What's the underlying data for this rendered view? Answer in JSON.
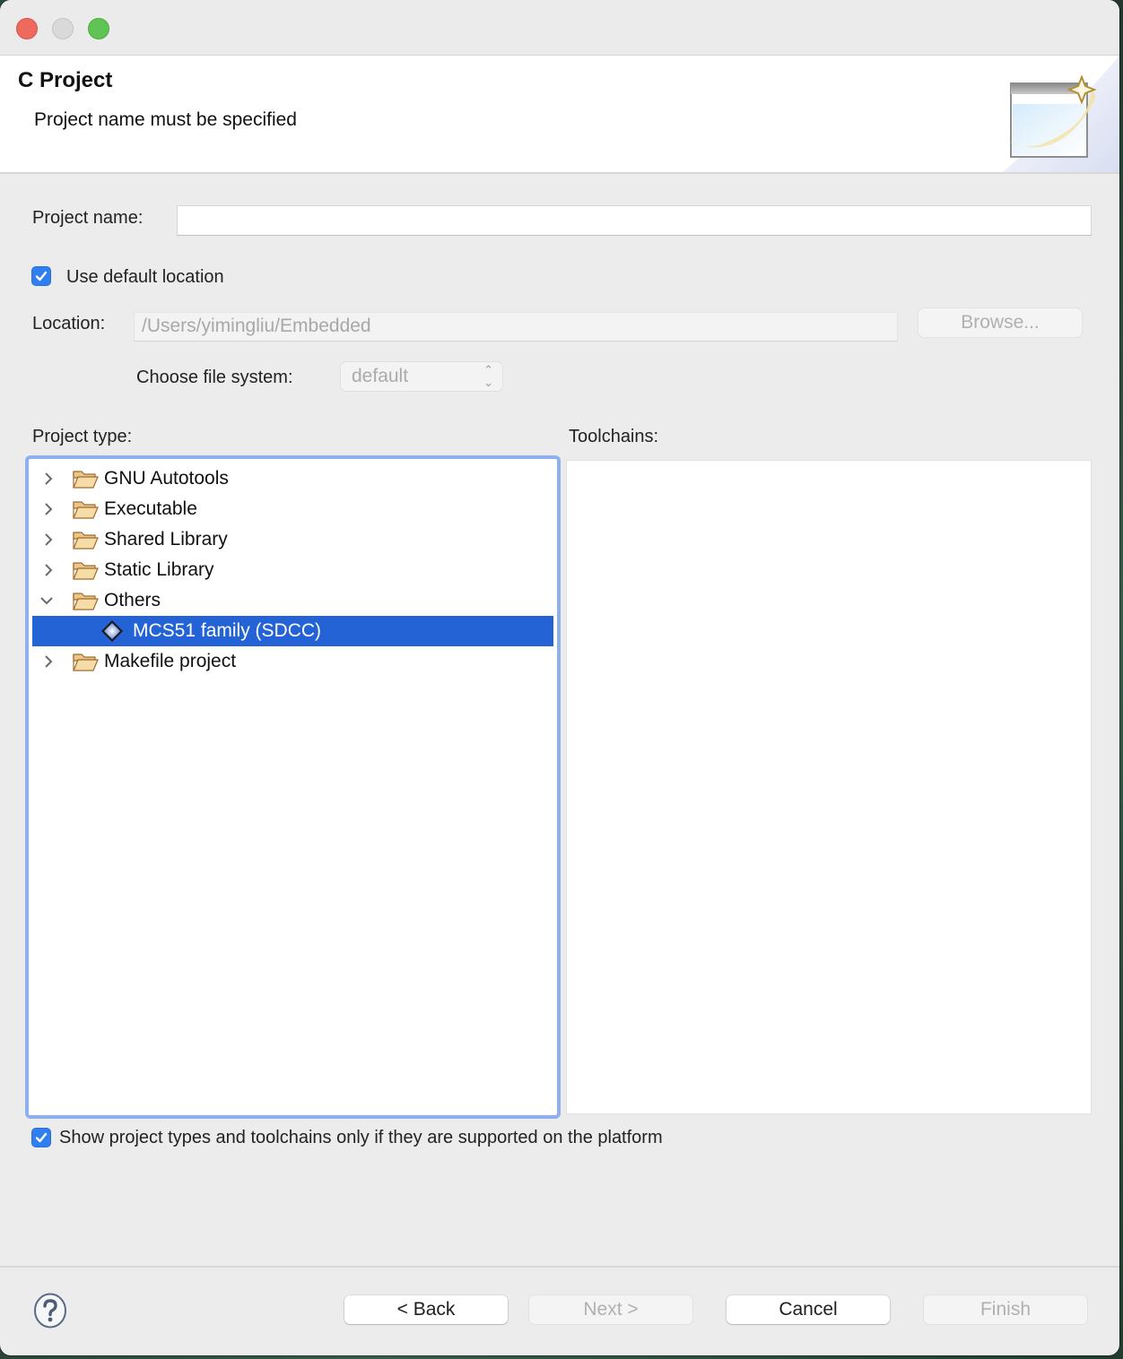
{
  "window": {
    "title_controls": [
      "close",
      "minimize",
      "maximize"
    ]
  },
  "banner": {
    "title": "C Project",
    "message": "Project name must be specified",
    "icon": "new-project-wizard-icon"
  },
  "form": {
    "project_name_label": "Project name:",
    "project_name_value": "",
    "use_default_location_label": "Use default location",
    "use_default_location_checked": true,
    "location_label": "Location:",
    "location_value": "/Users/yimingliu/Embedded",
    "browse_label": "Browse...",
    "file_system_label": "Choose file system:",
    "file_system_value": "default"
  },
  "project_types": {
    "label": "Project type:",
    "items": [
      {
        "label": "GNU Autotools",
        "type": "folder",
        "expanded": false
      },
      {
        "label": "Executable",
        "type": "folder",
        "expanded": false
      },
      {
        "label": "Shared Library",
        "type": "folder",
        "expanded": false
      },
      {
        "label": "Static Library",
        "type": "folder",
        "expanded": false
      },
      {
        "label": "Others",
        "type": "folder",
        "expanded": true
      },
      {
        "label": "MCS51 family (SDCC)",
        "type": "project-type",
        "selected": true
      },
      {
        "label": "Makefile project",
        "type": "folder",
        "expanded": false
      }
    ]
  },
  "toolchains": {
    "label": "Toolchains:",
    "items": []
  },
  "filter": {
    "label": "Show project types and toolchains only if they are supported on the platform",
    "checked": true
  },
  "footer": {
    "back_label": "< Back",
    "next_label": "Next >",
    "cancel_label": "Cancel",
    "finish_label": "Finish"
  },
  "colors": {
    "selection": "#2463d5",
    "focus_ring": "#8eb0ee",
    "checkbox": "#2f7ff0"
  }
}
